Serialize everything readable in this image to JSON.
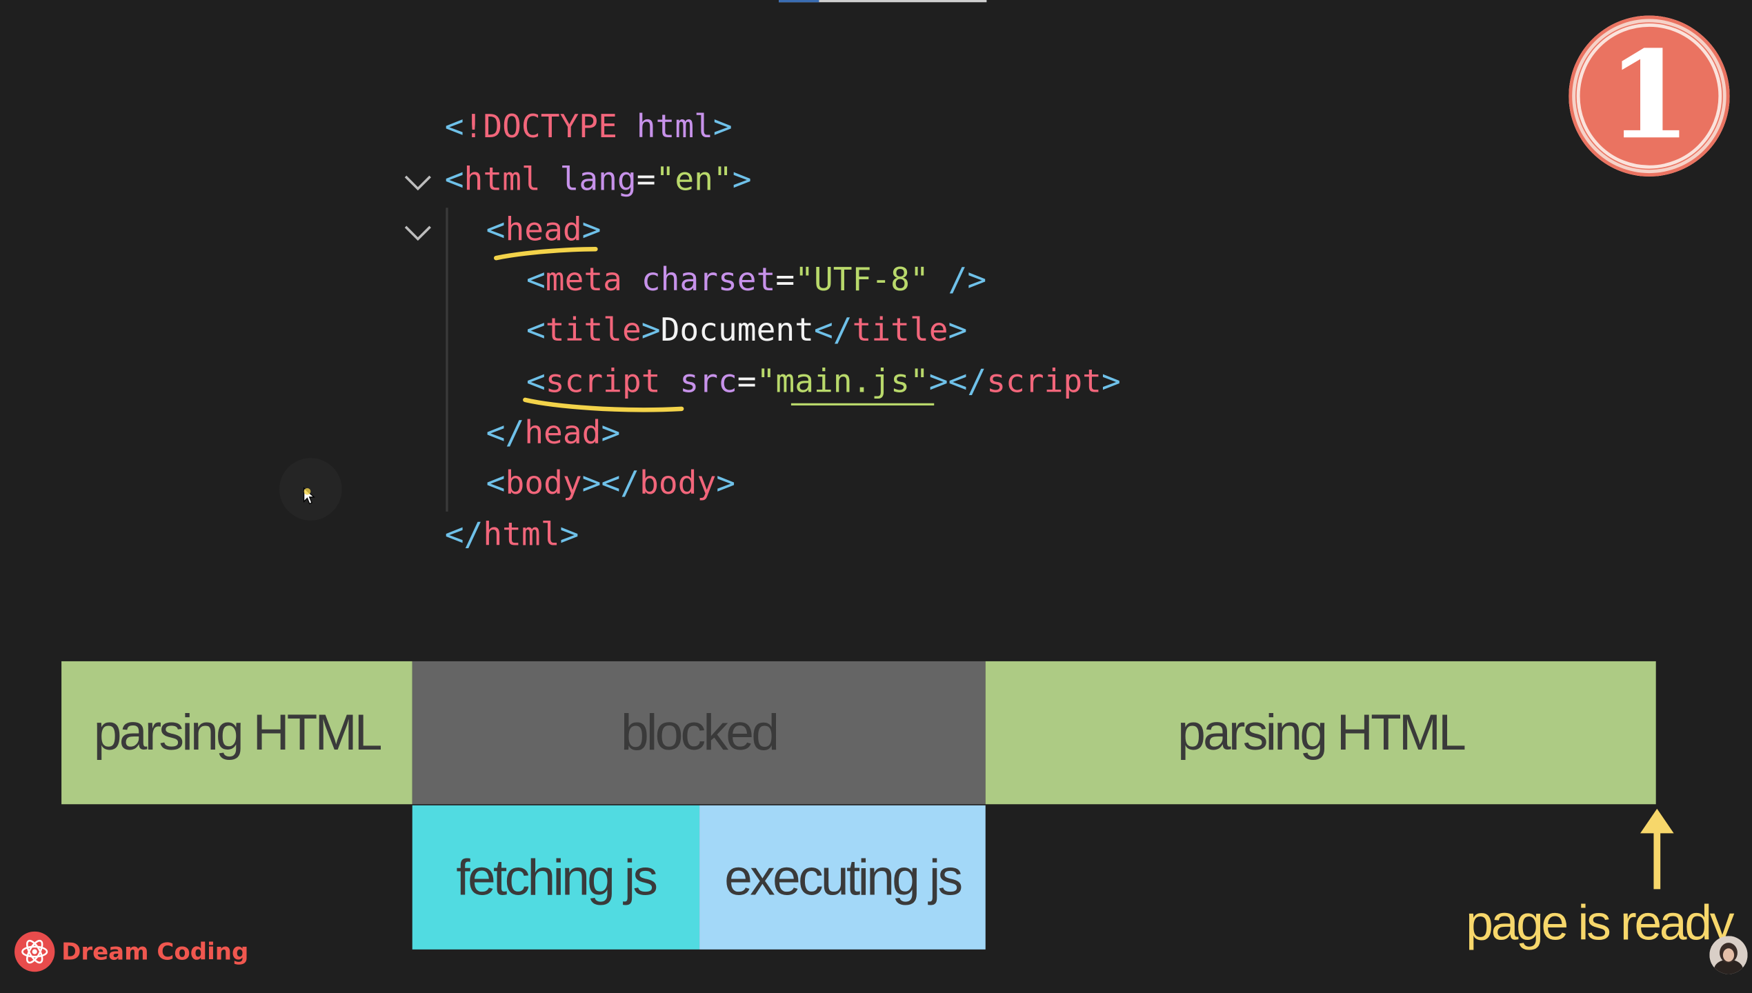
{
  "code": {
    "lines": [
      {
        "p": [
          [
            "tag",
            "<"
          ],
          [
            "tn",
            "!DOCTYPE"
          ],
          [
            "txt",
            " "
          ],
          [
            "attr",
            "html"
          ],
          [
            "tag",
            ">"
          ]
        ]
      },
      {
        "p": [
          [
            "tag",
            "<"
          ],
          [
            "tn",
            "html"
          ],
          [
            "txt",
            " "
          ],
          [
            "attr",
            "lang"
          ],
          [
            "txt",
            "="
          ],
          [
            "str",
            "\"en\""
          ],
          [
            "tag",
            ">"
          ]
        ]
      },
      {
        "p": [
          [
            "tag",
            "<"
          ],
          [
            "tn",
            "head"
          ],
          [
            "tag",
            ">"
          ]
        ]
      },
      {
        "p": [
          [
            "tag",
            "<"
          ],
          [
            "tn",
            "meta"
          ],
          [
            "txt",
            " "
          ],
          [
            "attr",
            "charset"
          ],
          [
            "txt",
            "="
          ],
          [
            "str",
            "\"UTF-8\""
          ],
          [
            "txt",
            " "
          ],
          [
            "tag",
            "/>"
          ]
        ]
      },
      {
        "p": [
          [
            "tag",
            "<"
          ],
          [
            "tn",
            "title"
          ],
          [
            "tag",
            ">"
          ],
          [
            "txt",
            "Document"
          ],
          [
            "tag",
            "</"
          ],
          [
            "tn",
            "title"
          ],
          [
            "tag",
            ">"
          ]
        ]
      },
      {
        "p": [
          [
            "tag",
            "<"
          ],
          [
            "tn",
            "script"
          ],
          [
            "txt",
            " "
          ],
          [
            "attr",
            "src"
          ],
          [
            "txt",
            "="
          ],
          [
            "str",
            "\""
          ],
          [
            "str",
            "main.js"
          ],
          [
            "str",
            "\""
          ],
          [
            "tag",
            "></"
          ],
          [
            "tn",
            "script"
          ],
          [
            "tag",
            ">"
          ]
        ]
      },
      {
        "p": [
          [
            "tag",
            "</"
          ],
          [
            "tn",
            "head"
          ],
          [
            "tag",
            ">"
          ]
        ]
      },
      {
        "p": [
          [
            "tag",
            "<"
          ],
          [
            "tn",
            "body"
          ],
          [
            "tag",
            "></"
          ],
          [
            "tn",
            "body"
          ],
          [
            "tag",
            ">"
          ]
        ]
      },
      {
        "p": [
          [
            "tag",
            "</"
          ],
          [
            "tn",
            "html"
          ],
          [
            "tag",
            ">"
          ]
        ]
      }
    ]
  },
  "badge": {
    "number": "1"
  },
  "timeline": {
    "parsing_1": "parsing HTML",
    "blocked": "blocked",
    "parsing_2": "parsing HTML",
    "fetching": "fetching js",
    "executing": "executing js",
    "ready": "page is ready"
  },
  "colors": {
    "parsing": "#adcb84",
    "blocked": "#656565",
    "fetching": "#51dbe1",
    "executing": "#a3d8f8",
    "highlight": "#f7d76b"
  },
  "brand": {
    "name": "Dream Coding"
  }
}
